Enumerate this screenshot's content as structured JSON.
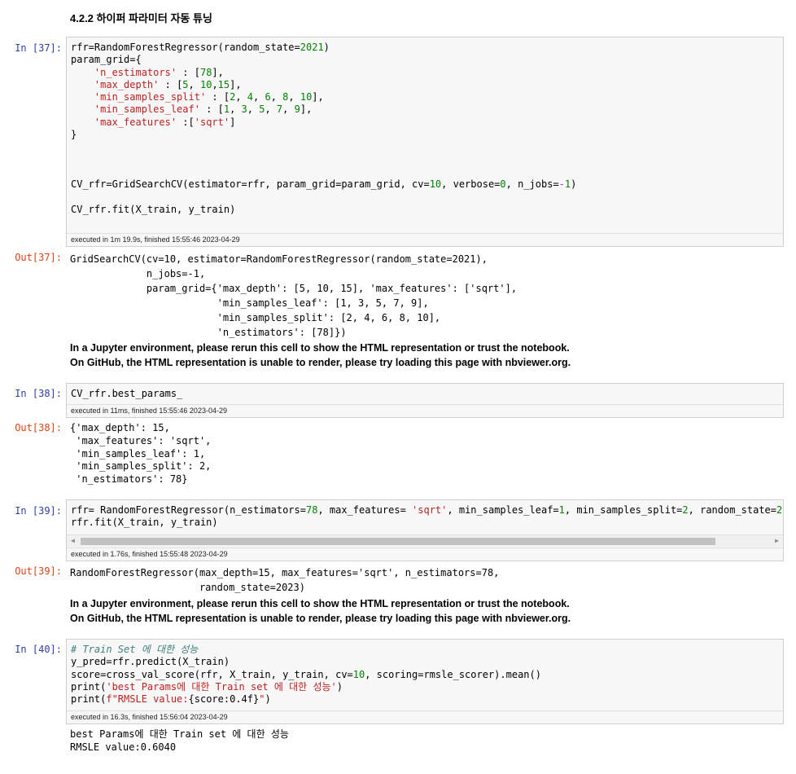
{
  "heading": "4.2.2  하이퍼 파라미터 자동 튜닝",
  "cells": [
    {
      "in_prompt": "In [37]:",
      "out_prompt": "Out[37]:",
      "exec": "executed in 1m 19.9s, finished 15:55:46 2023-04-29",
      "out_lines": [
        "GridSearchCV(cv=10, estimator=RandomForestRegressor(random_state=2021),",
        "             n_jobs=-1,",
        "             param_grid={'max_depth': [5, 10, 15], 'max_features': ['sqrt'],",
        "                         'min_samples_leaf': [1, 3, 5, 7, 9],",
        "                         'min_samples_split': [2, 4, 6, 8, 10],",
        "                         'n_estimators': [78]})"
      ],
      "warn1": "In a Jupyter environment, please rerun this cell to show the HTML representation or trust the notebook.",
      "warn2": "On GitHub, the HTML representation is unable to render, please try loading this page with nbviewer.org."
    },
    {
      "in_prompt": "In [38]:",
      "out_prompt": "Out[38]:",
      "code": "CV_rfr.best_params_",
      "exec": "executed in 11ms, finished 15:55:46 2023-04-29",
      "out_lines": [
        "{'max_depth': 15,",
        " 'max_features': 'sqrt',",
        " 'min_samples_leaf': 1,",
        " 'min_samples_split': 2,",
        " 'n_estimators': 78}"
      ]
    },
    {
      "in_prompt": "In [39]:",
      "out_prompt": "Out[39]:",
      "exec": "executed in 1.76s, finished 15:55:48 2023-04-29",
      "out_lines": [
        "RandomForestRegressor(max_depth=15, max_features='sqrt', n_estimators=78,",
        "                      random_state=2023)"
      ],
      "warn1": "In a Jupyter environment, please rerun this cell to show the HTML representation or trust the notebook.",
      "warn2": "On GitHub, the HTML representation is unable to render, please try loading this page with nbviewer.org."
    },
    {
      "in_prompt": "In [40]:",
      "exec": "executed in 16.3s, finished 15:56:04 2023-04-29",
      "out_lines": [
        "best Params에 대한 Train set 에 대한 성능",
        "RMSLE value:0.6040"
      ]
    }
  ]
}
